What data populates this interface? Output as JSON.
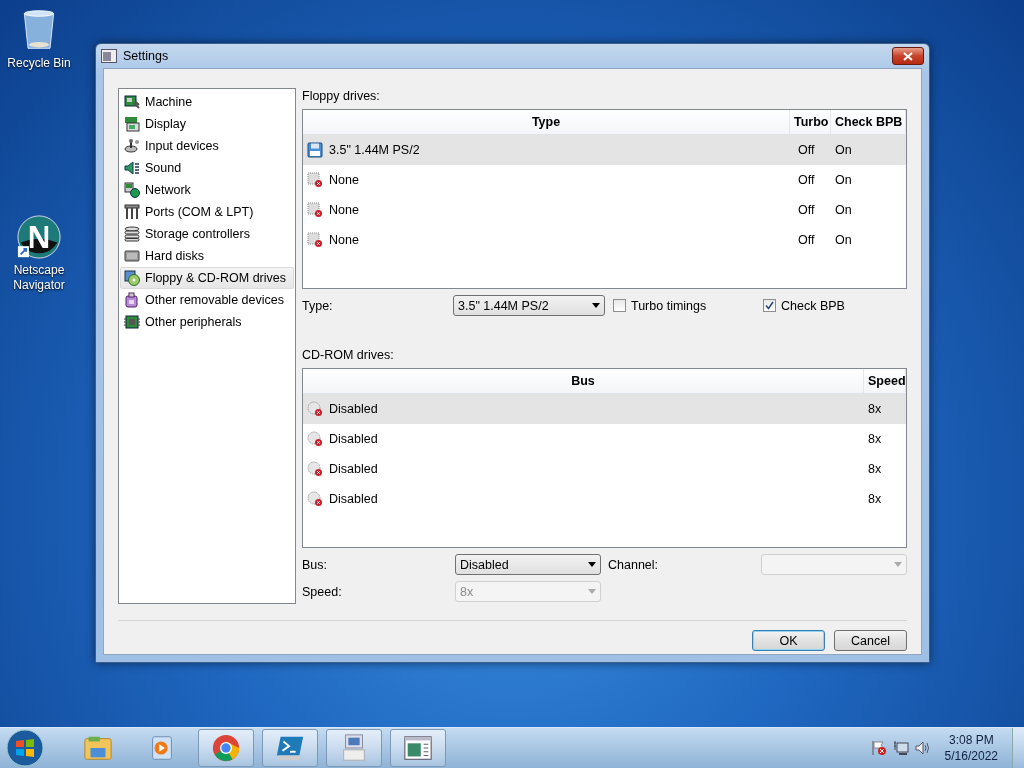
{
  "desktop_icons": [
    {
      "kind": "recycle",
      "label": "Recycle Bin"
    },
    {
      "kind": "netscape",
      "label": "Netscape Navigator"
    }
  ],
  "window": {
    "title": "Settings"
  },
  "sidebar": {
    "items": [
      {
        "kind": "machine",
        "label": "Machine",
        "selected": false
      },
      {
        "kind": "display",
        "label": "Display",
        "selected": false
      },
      {
        "kind": "input",
        "label": "Input devices",
        "selected": false
      },
      {
        "kind": "sound",
        "label": "Sound",
        "selected": false
      },
      {
        "kind": "network",
        "label": "Network",
        "selected": false
      },
      {
        "kind": "ports",
        "label": "Ports (COM & LPT)",
        "selected": false
      },
      {
        "kind": "storage",
        "label": "Storage controllers",
        "selected": false
      },
      {
        "kind": "harddisk",
        "label": "Hard disks",
        "selected": false
      },
      {
        "kind": "drives",
        "label": "Floppy & CD-ROM drives",
        "selected": true
      },
      {
        "kind": "removable",
        "label": "Other removable devices",
        "selected": false
      },
      {
        "kind": "peripherals",
        "label": "Other peripherals",
        "selected": false
      }
    ]
  },
  "floppy": {
    "label": "Floppy drives:",
    "columns": [
      "Type",
      "Turbo",
      "Check BPB"
    ],
    "rows": [
      {
        "kind": "floppy",
        "type": "3.5\" 1.44M PS/2",
        "turbo": "Off",
        "check_bpb": "On",
        "selected": true
      },
      {
        "kind": "none",
        "type": "None",
        "turbo": "Off",
        "check_bpb": "On",
        "selected": false
      },
      {
        "kind": "none",
        "type": "None",
        "turbo": "Off",
        "check_bpb": "On",
        "selected": false
      },
      {
        "kind": "none",
        "type": "None",
        "turbo": "Off",
        "check_bpb": "On",
        "selected": false
      }
    ],
    "type_field": {
      "label": "Type:",
      "value": "3.5\" 1.44M PS/2"
    },
    "turbo_timings": {
      "label": "Turbo timings",
      "checked": false
    },
    "check_bpb": {
      "label": "Check BPB",
      "checked": true
    }
  },
  "cdrom": {
    "label": "CD-ROM drives:",
    "columns": [
      "Bus",
      "Speed"
    ],
    "rows": [
      {
        "bus": "Disabled",
        "speed": "8x",
        "selected": true
      },
      {
        "bus": "Disabled",
        "speed": "8x",
        "selected": false
      },
      {
        "bus": "Disabled",
        "speed": "8x",
        "selected": false
      },
      {
        "bus": "Disabled",
        "speed": "8x",
        "selected": false
      }
    ],
    "bus_field": {
      "label": "Bus:",
      "value": "Disabled",
      "disabled": false
    },
    "channel_field": {
      "label": "Channel:",
      "disabled": true
    },
    "speed_field": {
      "label": "Speed:",
      "value": "8x",
      "disabled": true
    }
  },
  "buttons": [
    {
      "label": "OK",
      "default": true
    },
    {
      "label": "Cancel",
      "default": false
    }
  ],
  "taskbar": {
    "items": [
      {
        "kind": "explorer",
        "running": false
      },
      {
        "kind": "media",
        "running": false
      },
      {
        "kind": "chrome",
        "running": true
      },
      {
        "kind": "powershell",
        "running": true
      },
      {
        "kind": "computer",
        "running": true
      },
      {
        "kind": "window",
        "running": true
      }
    ],
    "time": "3:08 PM",
    "date": "5/16/2022"
  }
}
